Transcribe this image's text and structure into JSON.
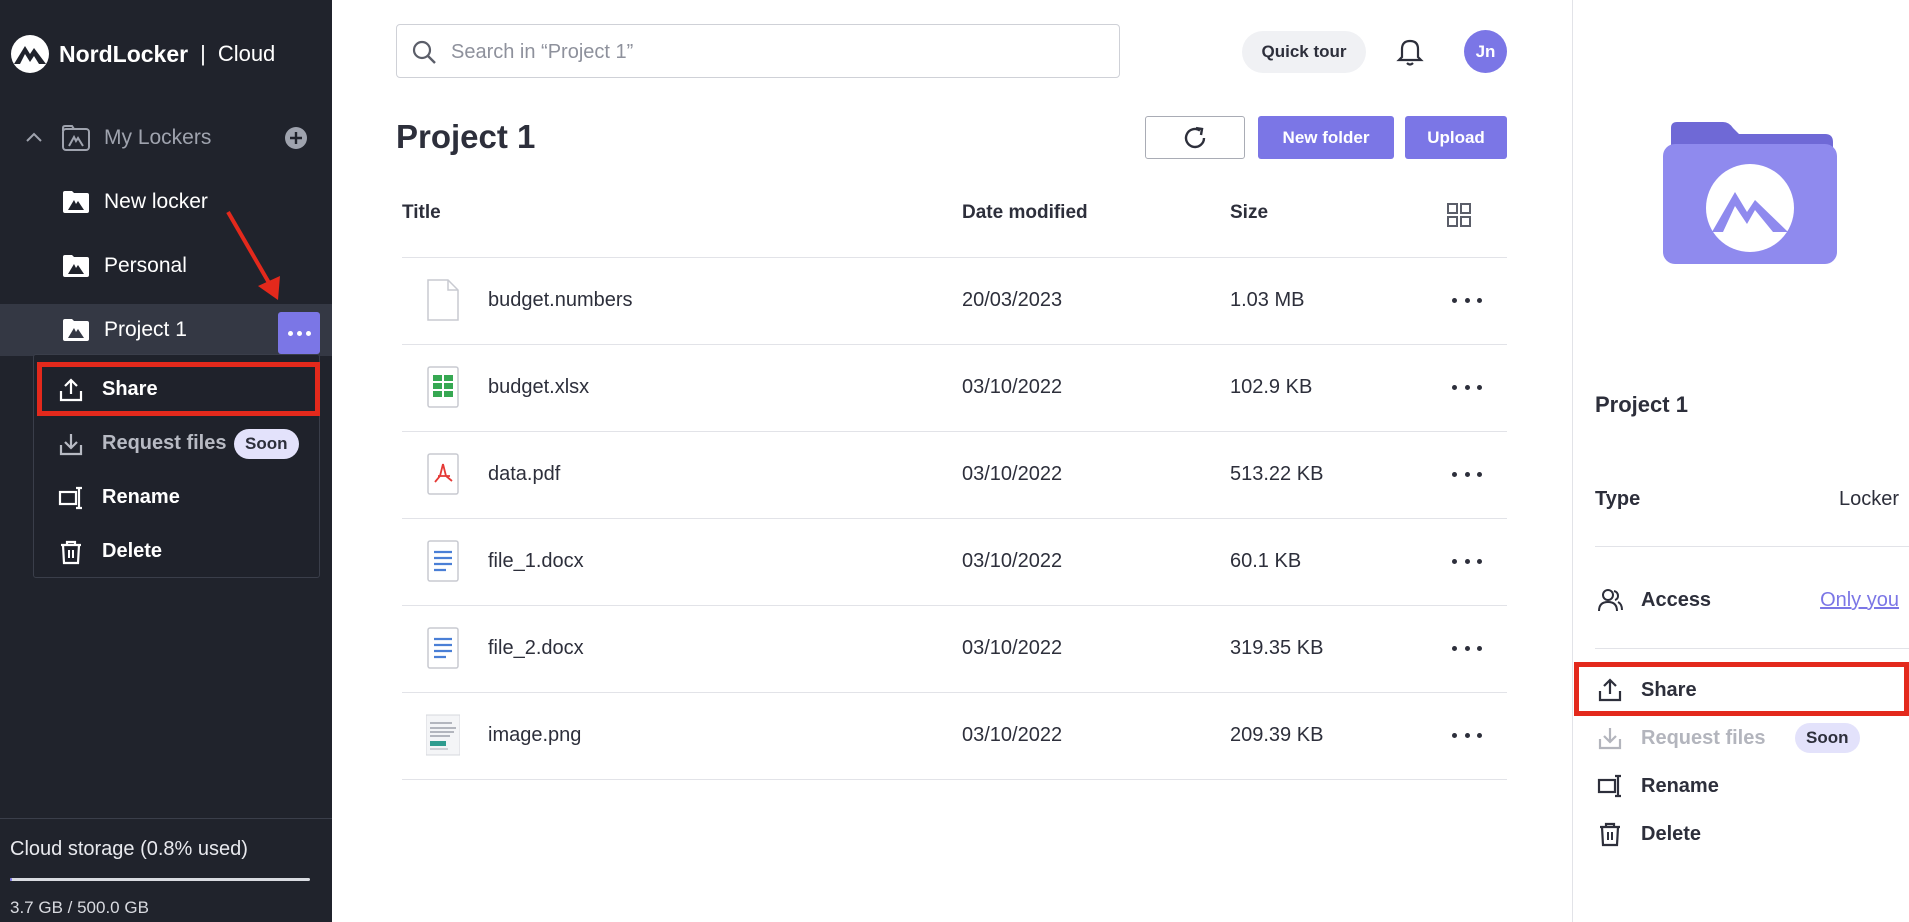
{
  "brand": {
    "name": "NordLocker",
    "separator": "|",
    "sub": "Cloud"
  },
  "sidebar": {
    "section_label": "My Lockers",
    "items": [
      {
        "label": "New locker"
      },
      {
        "label": "Personal"
      },
      {
        "label": "Project 1"
      }
    ],
    "context_menu": [
      {
        "label": "Share"
      },
      {
        "label": "Request files",
        "badge": "Soon"
      },
      {
        "label": "Rename"
      },
      {
        "label": "Delete"
      }
    ],
    "storage": {
      "label": "Cloud storage (0.8% used)",
      "value": "3.7 GB / 500.0 GB",
      "used_fraction": 0.008
    }
  },
  "header": {
    "search_placeholder": "Search in “Project 1”",
    "quick_tour": "Quick tour",
    "avatar_initials": "Jn"
  },
  "main": {
    "title": "Project 1",
    "new_folder": "New folder",
    "upload": "Upload",
    "columns": {
      "title": "Title",
      "date": "Date modified",
      "size": "Size"
    },
    "files": [
      {
        "name": "budget.numbers",
        "date": "20/03/2023",
        "size": "1.03 MB",
        "icon": "generic-file-icon"
      },
      {
        "name": "budget.xlsx",
        "date": "03/10/2022",
        "size": "102.9 KB",
        "icon": "spreadsheet-file-icon"
      },
      {
        "name": "data.pdf",
        "date": "03/10/2022",
        "size": "513.22 KB",
        "icon": "pdf-file-icon"
      },
      {
        "name": "file_1.docx",
        "date": "03/10/2022",
        "size": "60.1 KB",
        "icon": "document-file-icon"
      },
      {
        "name": "file_2.docx",
        "date": "03/10/2022",
        "size": "319.35 KB",
        "icon": "document-file-icon"
      },
      {
        "name": "image.png",
        "date": "03/10/2022",
        "size": "209.39 KB",
        "icon": "image-thumbnail-icon"
      }
    ]
  },
  "details": {
    "title": "Project 1",
    "type_label": "Type",
    "type_value": "Locker",
    "access_label": "Access",
    "access_value": "Only you",
    "actions": [
      {
        "label": "Share"
      },
      {
        "label": "Request files",
        "badge": "Soon"
      },
      {
        "label": "Rename"
      },
      {
        "label": "Delete"
      }
    ]
  },
  "colors": {
    "sidebar_bg": "#20232c",
    "accent": "#7b76e6",
    "highlight": "#e3291c"
  }
}
